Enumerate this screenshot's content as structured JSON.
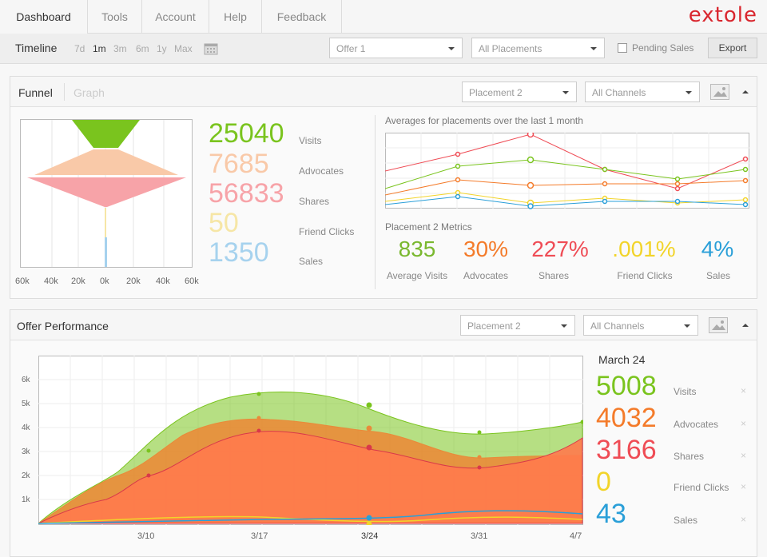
{
  "nav": {
    "tabs": [
      "Dashboard",
      "Tools",
      "Account",
      "Help",
      "Feedback"
    ],
    "logo": "extole"
  },
  "toolbar": {
    "timeline_label": "Timeline",
    "ranges": [
      "7d",
      "1m",
      "3m",
      "6m",
      "1y",
      "Max"
    ],
    "active_range": "1m",
    "offer_select": "Offer 1",
    "placements_select": "All Placements",
    "pending_sales_label": "Pending Sales",
    "pending_sales_checked": false,
    "export_label": "Export"
  },
  "funnel_panel": {
    "tab_funnel": "Funnel",
    "tab_graph": "Graph",
    "placement_select": "Placement 2",
    "channel_select": "All Channels",
    "x_ticks": [
      "60k",
      "40k",
      "20k",
      "0k",
      "20k",
      "40k",
      "60k"
    ],
    "metrics": [
      {
        "value": "25040",
        "label": "Visits",
        "color": "#7ac41e"
      },
      {
        "value": "7685",
        "label": "Advocates",
        "color": "#f9c9a8"
      },
      {
        "value": "56833",
        "label": "Shares",
        "color": "#f7a3a8"
      },
      {
        "value": "50",
        "label": "Friend Clicks",
        "color": "#f6e6a6"
      },
      {
        "value": "1350",
        "label": "Sales",
        "color": "#a6d2ee"
      }
    ],
    "averages_title": "Averages for placements over the last 1 month",
    "placement_metrics_title": "Placement 2 Metrics",
    "placement_metrics": [
      {
        "value": "835",
        "label": "Average Visits",
        "color": "#7ab82f"
      },
      {
        "value": "30%",
        "label": "Advocates",
        "color": "#f47b2a"
      },
      {
        "value": "227%",
        "label": "Shares",
        "color": "#ef4c55"
      },
      {
        "value": ".001%",
        "label": "Friend Clicks",
        "color": "#f2d42a"
      },
      {
        "value": "4%",
        "label": "Sales",
        "color": "#2a9fd8"
      }
    ]
  },
  "offer_panel": {
    "title": "Offer Performance",
    "placement_select": "Placement 2",
    "channel_select": "All Channels",
    "date_label": "March 24",
    "y_ticks": [
      "1k",
      "2k",
      "3k",
      "4k",
      "5k",
      "6k"
    ],
    "x_ticks": [
      "3/10",
      "3/17",
      "3/24",
      "3/31",
      "4/7"
    ],
    "metrics": [
      {
        "value": "5008",
        "label": "Visits",
        "color": "#7ac41e"
      },
      {
        "value": "4032",
        "label": "Advocates",
        "color": "#f47b2a"
      },
      {
        "value": "3166",
        "label": "Shares",
        "color": "#ef4c55"
      },
      {
        "value": "0",
        "label": "Friend Clicks",
        "color": "#f2d42a"
      },
      {
        "value": "43",
        "label": "Sales",
        "color": "#2a9fd8"
      }
    ],
    "close_glyph": "×"
  },
  "colors": {
    "visits": "#7ac41e",
    "advocates": "#f47b2a",
    "shares": "#ef4c55",
    "friend_clicks": "#f2d42a",
    "sales": "#2a9fd8",
    "brand": "#d9262e"
  }
}
